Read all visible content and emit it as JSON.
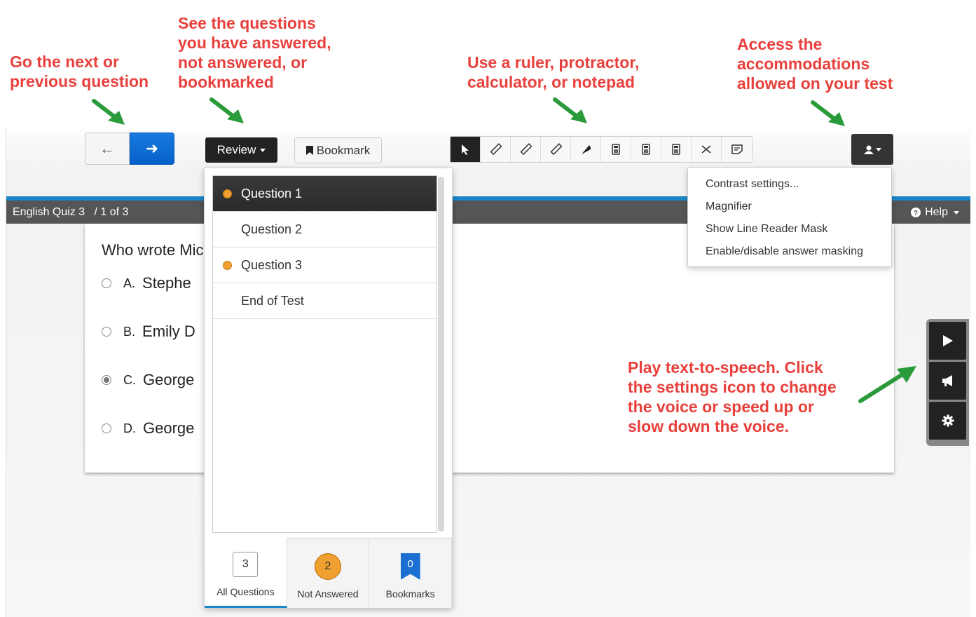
{
  "annotations": {
    "nav": "Go the next or\nprevious question",
    "review": "See the questions\nyou have answered,\nnot answered, or\nbookmarked",
    "tools": "Use a ruler, protractor,\ncalculator, or notepad",
    "accommodations": "Access the\naccommodations\nallowed on your test",
    "tts": "Play text-to-speech. Click\nthe settings icon to change\nthe voice or speed up or\nslow down the voice."
  },
  "toolbar": {
    "review_label": "Review",
    "bookmark_label": "Bookmark",
    "tools": [
      "pointer-icon",
      "ruler-icon",
      "ruler-icon",
      "ruler-icon",
      "protractor-icon",
      "calculator-icon",
      "calculator-icon",
      "calculator-icon",
      "cross-out-icon",
      "notepad-icon"
    ]
  },
  "header": {
    "quiz_title": "English Quiz 3",
    "position": "/ 1 of 3",
    "help_label": "Help"
  },
  "question": {
    "text": "Who wrote Mic",
    "options": [
      {
        "letter": "A.",
        "text": "Stephe",
        "selected": false
      },
      {
        "letter": "B.",
        "text": "Emily D",
        "selected": false
      },
      {
        "letter": "C.",
        "text": "George",
        "selected": true
      },
      {
        "letter": "D.",
        "text": "George",
        "selected": false
      }
    ]
  },
  "review": {
    "items": [
      {
        "label": "Question 1",
        "unanswered": true,
        "selected": true
      },
      {
        "label": "Question 2",
        "unanswered": false,
        "selected": false
      },
      {
        "label": "Question 3",
        "unanswered": true,
        "selected": false
      },
      {
        "label": "End of Test",
        "unanswered": false,
        "selected": false
      }
    ],
    "tabs": {
      "all_count": "3",
      "all_label": "All Questions",
      "not_answered_count": "2",
      "not_answered_label": "Not Answered",
      "bookmarks_count": "0",
      "bookmarks_label": "Bookmarks"
    }
  },
  "accommodations": {
    "items": [
      "Contrast settings...",
      "Magnifier",
      "Show Line Reader Mask",
      "Enable/disable answer masking"
    ]
  },
  "colors": {
    "annotation": "#e8403c",
    "arrow": "#2a9a3a",
    "accent_blue": "#1a86c8",
    "unanswered_orange": "#f0a030"
  }
}
